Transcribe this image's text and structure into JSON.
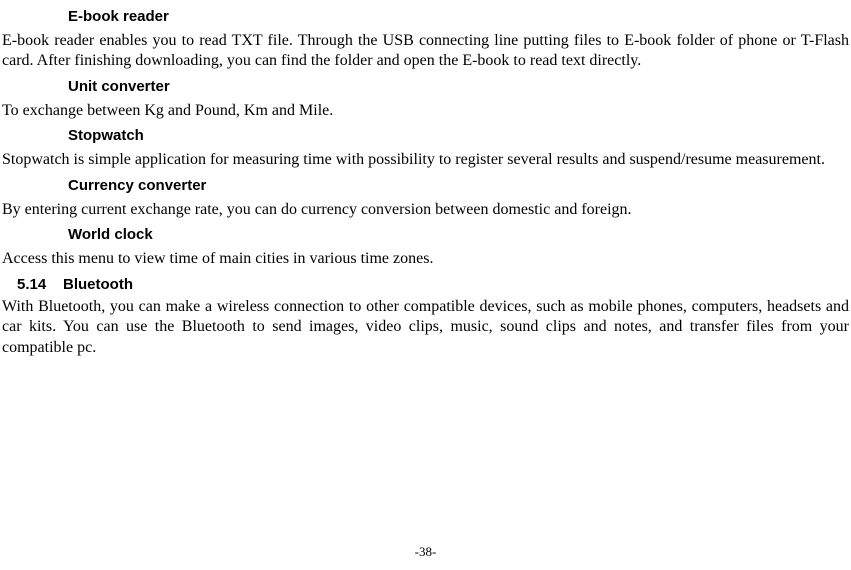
{
  "sections": {
    "ebook": {
      "heading": "E-book reader",
      "body": "E-book reader enables you to read TXT file. Through the USB connecting line putting files to E-book folder of phone or T-Flash card. After finishing downloading, you can find the folder and open the E-book to read text directly."
    },
    "unit": {
      "heading": "Unit converter",
      "body": "To exchange between Kg and Pound, Km and Mile."
    },
    "stopwatch": {
      "heading": "Stopwatch",
      "body": "Stopwatch is simple application for measuring time with possibility to register several results and suspend/resume measurement."
    },
    "currency": {
      "heading": "Currency converter",
      "body": "By entering current exchange rate, you can do currency conversion between domestic and foreign."
    },
    "worldclock": {
      "heading": "World clock",
      "body": "Access this menu to view time of main cities in various time zones."
    },
    "bluetooth": {
      "number": "5.14",
      "heading": "Bluetooth",
      "body": "With Bluetooth, you can make a wireless connection to other compatible devices, such as mobile phones, computers, headsets and car kits. You can use the Bluetooth to send images, video clips, music, sound clips and notes, and transfer files from your compatible pc."
    }
  },
  "page_number": "-38-"
}
